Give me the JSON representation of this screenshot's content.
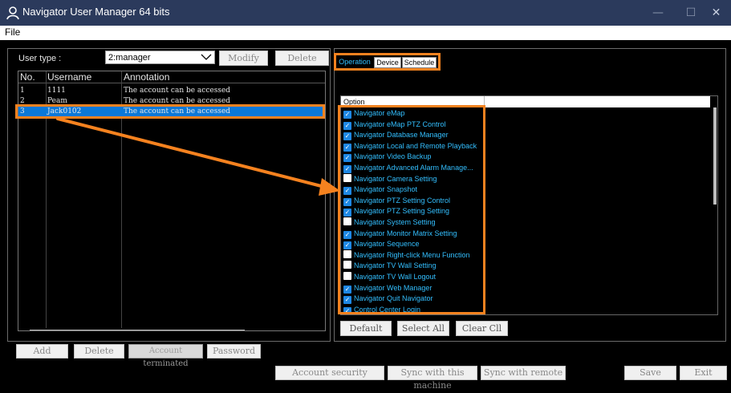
{
  "window": {
    "title": "Navigator User Manager 64 bits",
    "minimize_glyph": "—",
    "maximize_glyph": "☐",
    "close_glyph": "✕",
    "icon": "user-icon"
  },
  "menu": {
    "file": "File"
  },
  "left": {
    "user_type_label": "User type :",
    "user_type_value": "2:manager",
    "modify": "Modify",
    "delete_top": "Delete",
    "columns": [
      "No.",
      "Username",
      "Annotation"
    ],
    "rows": [
      {
        "no": "1",
        "username": "1111",
        "annotation": "The account can be accessed"
      },
      {
        "no": "2",
        "username": "Peam",
        "annotation": "The account can be accessed"
      },
      {
        "no": "3",
        "username": "Jack0102",
        "annotation": "The account can be accessed"
      }
    ],
    "selected_row_index": 2,
    "buttons": {
      "add": "Add",
      "delete": "Delete",
      "account_terminated": "Account terminated",
      "password": "Password"
    }
  },
  "right": {
    "tabs": [
      "Operation",
      "Device",
      "Schedule"
    ],
    "active_tab": "Operation",
    "option_header": "Option",
    "options": [
      {
        "label": "Navigator eMap",
        "checked": true
      },
      {
        "label": "Navigator eMap PTZ Control",
        "checked": true
      },
      {
        "label": "Navigator Database Manager",
        "checked": true
      },
      {
        "label": "Navigator Local and Remote Playback",
        "checked": true
      },
      {
        "label": "Navigator Video Backup",
        "checked": true
      },
      {
        "label": "Navigator Advanced Alarm Manage...",
        "checked": true
      },
      {
        "label": "Navigator Camera Setting",
        "checked": false
      },
      {
        "label": "Navigator Snapshot",
        "checked": true
      },
      {
        "label": "Navigator PTZ Setting Control",
        "checked": true
      },
      {
        "label": "Navigator PTZ Setting Setting",
        "checked": true
      },
      {
        "label": "Navigator System Setting",
        "checked": false
      },
      {
        "label": "Navigator Monitor Matrix Setting",
        "checked": true
      },
      {
        "label": "Navigator Sequence",
        "checked": true
      },
      {
        "label": "Navigator Right-click Menu Function",
        "checked": false
      },
      {
        "label": "Navigator TV Wall Setting",
        "checked": false
      },
      {
        "label": "Navigator TV Wall Logout",
        "checked": false
      },
      {
        "label": "Navigator Web Manager",
        "checked": true
      },
      {
        "label": "Navigator Quit Navigator",
        "checked": true
      },
      {
        "label": "Control Center Login",
        "checked": true
      }
    ],
    "buttons": {
      "default": "Default",
      "select_all": "Select All",
      "clear_all": "Clear Cll"
    }
  },
  "bottom": {
    "account_security": "Account security",
    "sync_machine": "Sync with this machine",
    "sync_remote": "Sync with remote",
    "save": "Save",
    "exit": "Exit"
  },
  "colors": {
    "titlebar": "#2b3a5c",
    "highlight": "#f5821f",
    "selection": "#0a78d7",
    "option_text": "#33bfff"
  }
}
